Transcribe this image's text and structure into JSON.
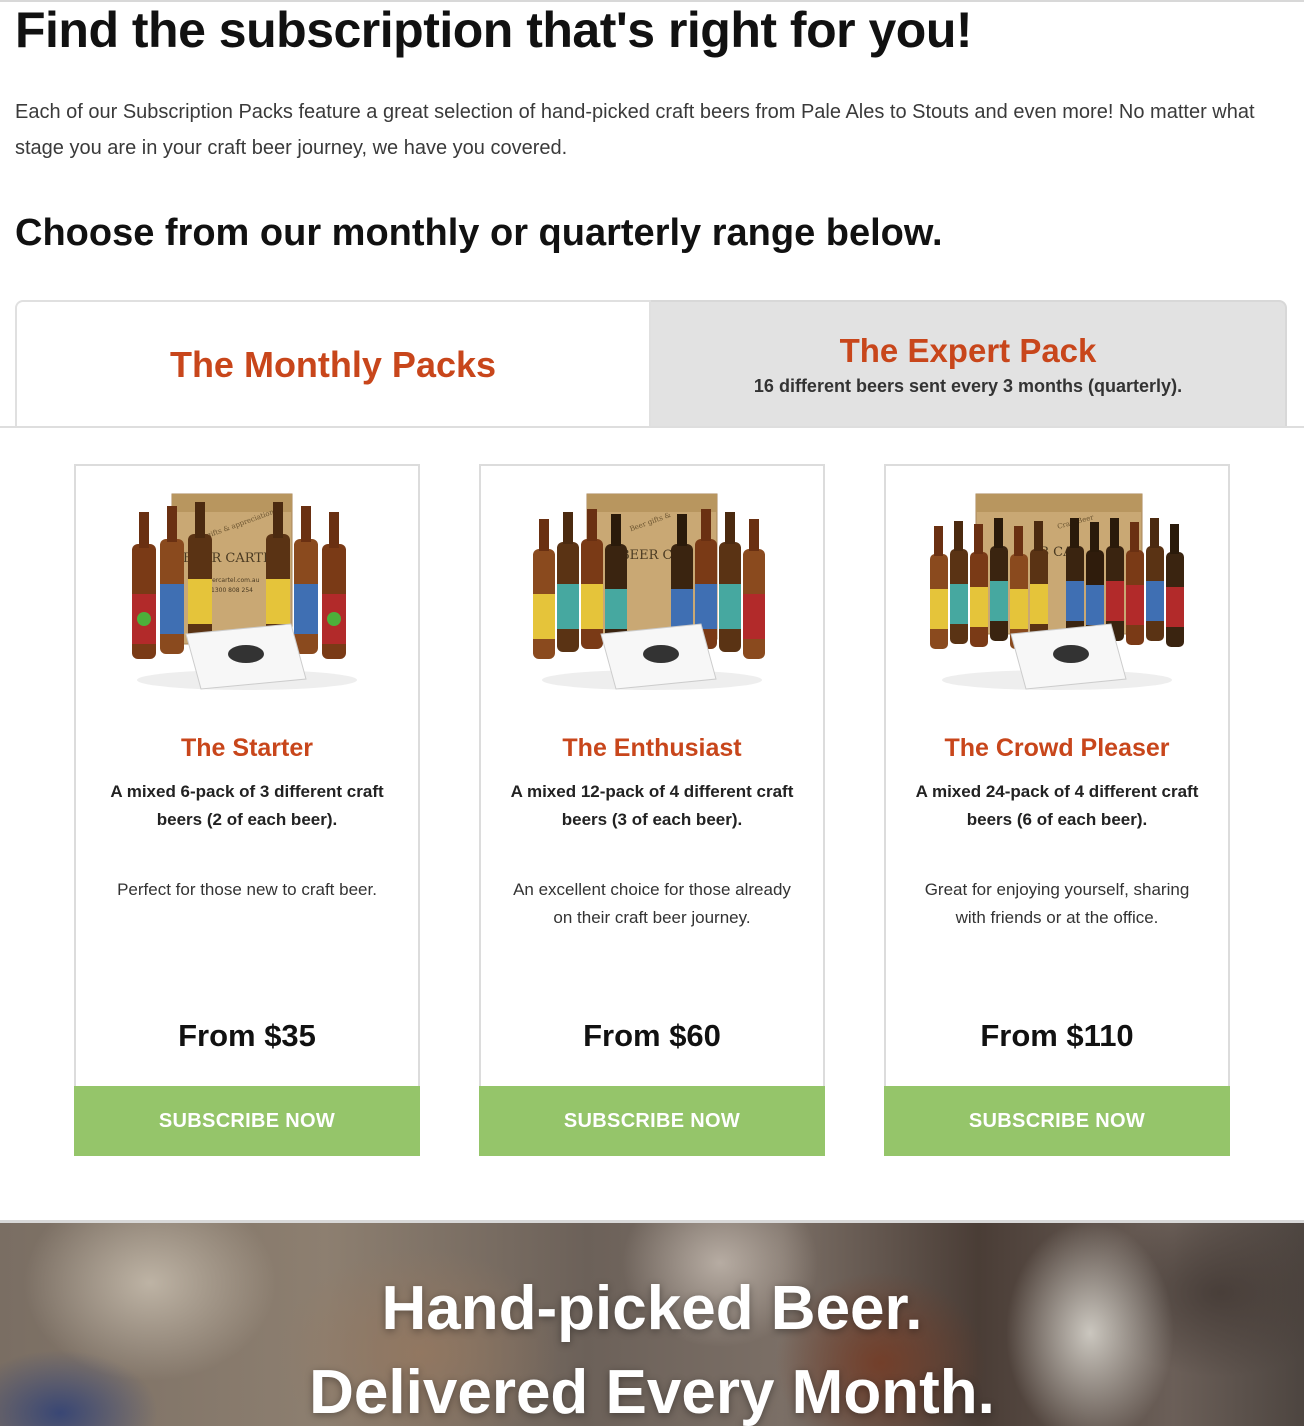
{
  "page": {
    "title": "Find the subscription that's right for you!",
    "intro": "Each of our Subscription Packs feature a great selection of hand-picked craft beers from Pale Ales to Stouts and even more! No matter what stage you are in your craft beer journey, we have you covered.",
    "subhead": "Choose from our monthly or quarterly range below."
  },
  "tabs": [
    {
      "label": "The Monthly Packs",
      "sub": "",
      "active": true
    },
    {
      "label": "The Expert Pack",
      "sub": "16 different beers sent every 3 months (quarterly).",
      "active": false
    }
  ],
  "cards": [
    {
      "title": "The Starter",
      "desc": "A mixed 6-pack of 3 different craft beers (2 of each beer).",
      "blurb": "Perfect for those new to craft beer.",
      "price": "From $35",
      "button": "SUBSCRIBE NOW",
      "image_text": {
        "box": "BEER CARTEL",
        "box_small": "Beer gifts & appreciation",
        "url": "beercartel.com.au",
        "phone": "1300 808 254"
      }
    },
    {
      "title": "The Enthusiast",
      "desc": "A mixed 12-pack of 4 different craft beers (3 of each beer).",
      "blurb": "An excellent choice for those already on their craft beer journey.",
      "price": "From $60",
      "button": "SUBSCRIBE NOW",
      "image_text": {
        "box": "BEER CA",
        "box_small": "Beer gifts &",
        "url": "",
        "phone": ""
      }
    },
    {
      "title": "The Crowd Pleaser",
      "desc": "A mixed 24-pack of 4 different craft beers (6 of each beer).",
      "blurb": "Great for enjoying yourself, sharing with friends or at the office.",
      "price": "From $110",
      "button": "SUBSCRIBE NOW",
      "image_text": {
        "box": "B CA",
        "box_small": "Craft Beer",
        "url": "",
        "phone": ""
      }
    }
  ],
  "hero": {
    "line1": "Hand-picked Beer.",
    "line2": "Delivered Every Month."
  },
  "colors": {
    "accent": "#c8461b",
    "button": "#95c56a",
    "tab_inactive": "#e2e2e2"
  }
}
